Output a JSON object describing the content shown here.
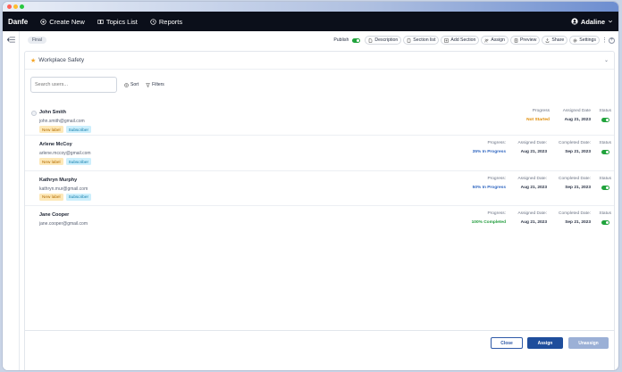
{
  "header": {
    "brand": "Danfe",
    "nav": [
      {
        "label": "Create New",
        "icon": "plus-circle-icon"
      },
      {
        "label": "Topics List",
        "icon": "book-icon"
      },
      {
        "label": "Reports",
        "icon": "clock-icon"
      }
    ],
    "user": "Adaline"
  },
  "toolbar": {
    "status_chip": "Final",
    "publish_label": "Publish",
    "buttons": [
      "Description",
      "Section list",
      "Add Section",
      "Assign",
      "Preview",
      "Share",
      "Settings"
    ]
  },
  "section": {
    "title": "Workplace Safety"
  },
  "filters": {
    "search_placeholder": "Search users...",
    "sort": "Sort",
    "filters": "Filters"
  },
  "users": [
    {
      "name": "John Smith",
      "email": "john.smith@gmail.com",
      "tags": [
        "New label",
        "Subscriber"
      ],
      "progress_label": "Progress",
      "progress": "Not Started",
      "assigned_label": "Assigned Date",
      "assigned": "Aug 21, 2023",
      "completed_label": "",
      "completed": "",
      "status_label": "Status"
    },
    {
      "name": "Arlene McCoy",
      "email": "arlene.mccoy@gmail.com",
      "tags": [
        "New label",
        "Subscriber"
      ],
      "progress_label": "Progress:",
      "progress": "35% In Progress",
      "assigned_label": "Assigned Date:",
      "assigned": "Aug 21, 2023",
      "completed_label": "Completed Date:",
      "completed": "Sep 21, 2023",
      "status_label": "Status"
    },
    {
      "name": "Kathryn Murphy",
      "email": "kathryn.mur@gmail.com",
      "tags": [
        "New label",
        "Subscriber"
      ],
      "progress_label": "Progress:",
      "progress": "50% In Progress",
      "assigned_label": "Assigned Date:",
      "assigned": "Aug 21, 2023",
      "completed_label": "Completed Date:",
      "completed": "Sep 21, 2023",
      "status_label": "Status"
    },
    {
      "name": "Jane Cooper",
      "email": "jane.cooper@gmail.com",
      "tags": [],
      "progress_label": "Progress:",
      "progress": "100% Completed",
      "assigned_label": "Assigned Date:",
      "assigned": "Aug 21, 2023",
      "completed_label": "Completed Date:",
      "completed": "Sep 21, 2023",
      "status_label": "Status"
    }
  ],
  "footer": {
    "close": "Close",
    "assign": "Assign",
    "unassign": "Unassign"
  },
  "colors": {
    "accent": "#1f4e9c",
    "toggle_on": "#21a33c",
    "not_started": "#e08a00",
    "in_progress": "#2f66c0",
    "completed": "#1f9b3a"
  }
}
